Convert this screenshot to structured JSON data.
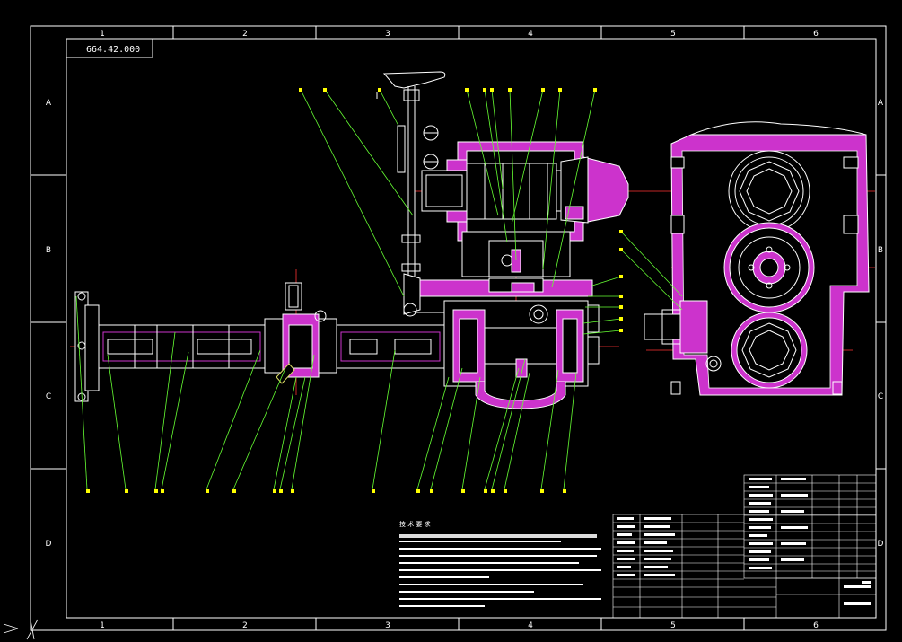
{
  "drawing": {
    "number": "664.42.000",
    "columns": [
      "1",
      "2",
      "3",
      "4",
      "5",
      "6"
    ],
    "rows": [
      "A",
      "B",
      "C",
      "D"
    ]
  },
  "notes": {
    "heading": "技 术 要 求"
  },
  "colors": {
    "background": "#000000",
    "frame": "#ffffff",
    "outline": "#ffffff",
    "section": "#cc33cc",
    "leader": "#66ff33",
    "centerline": "#ff3333",
    "balloon": "#ffff00",
    "highlight": "#dddd66"
  }
}
